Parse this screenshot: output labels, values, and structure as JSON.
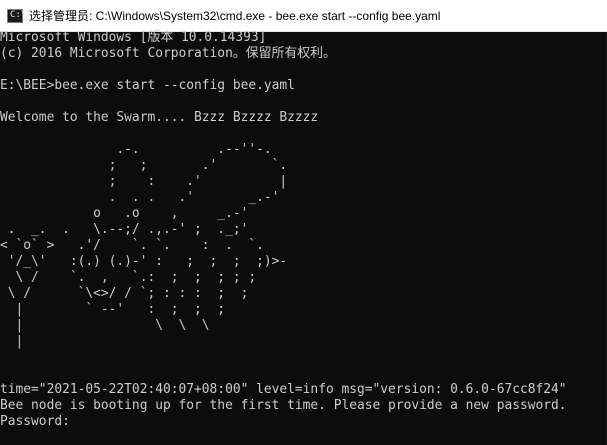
{
  "window": {
    "title": "选择管理员: C:\\Windows\\System32\\cmd.exe - bee.exe  start --config bee.yaml",
    "icon": "terminal-icon"
  },
  "console": {
    "lines": [
      "Microsoft Windows [版本 10.0.14393]",
      "(c) 2016 Microsoft Corporation。保留所有权利。",
      "",
      "E:\\BEE>bee.exe start --config bee.yaml",
      "",
      "Welcome to the Swarm.... Bzzz Bzzzz Bzzzz",
      "",
      "               .-.          .--''-.",
      "              ;   ;       .'       `.",
      "              ;    :    .'          |",
      "              .  . .   .'       _.-'",
      "            o   .o    ,     _.-'",
      " .  _.  .   \\.--;/ .,.-' ;  ._;' ",
      "< `o` >   .'/    `. `.    :  .  `.",
      " '/_\\'   :(.) (.)-' :   ;  ;  ;  ;)>-",
      "  \\ /    `.  ,   `.:  ;  ;  ; ; ;",
      " \\ /      `\\<>/ / `; : : :  ;  ;",
      "  |        ` --'   :  ;  ;  ;",
      "  |                 \\  \\  \\",
      "  |",
      "",
      "",
      "time=\"2021-05-22T02:40:07+08:00\" level=info msg=\"version: 0.6.0-67cc8f24\"",
      "Bee node is booting up for the first time. Please provide a new password.",
      "Password:"
    ]
  },
  "colors": {
    "console_background": "#0c0c0c",
    "console_text": "#cccccc",
    "titlebar_background": "#ffffff"
  }
}
